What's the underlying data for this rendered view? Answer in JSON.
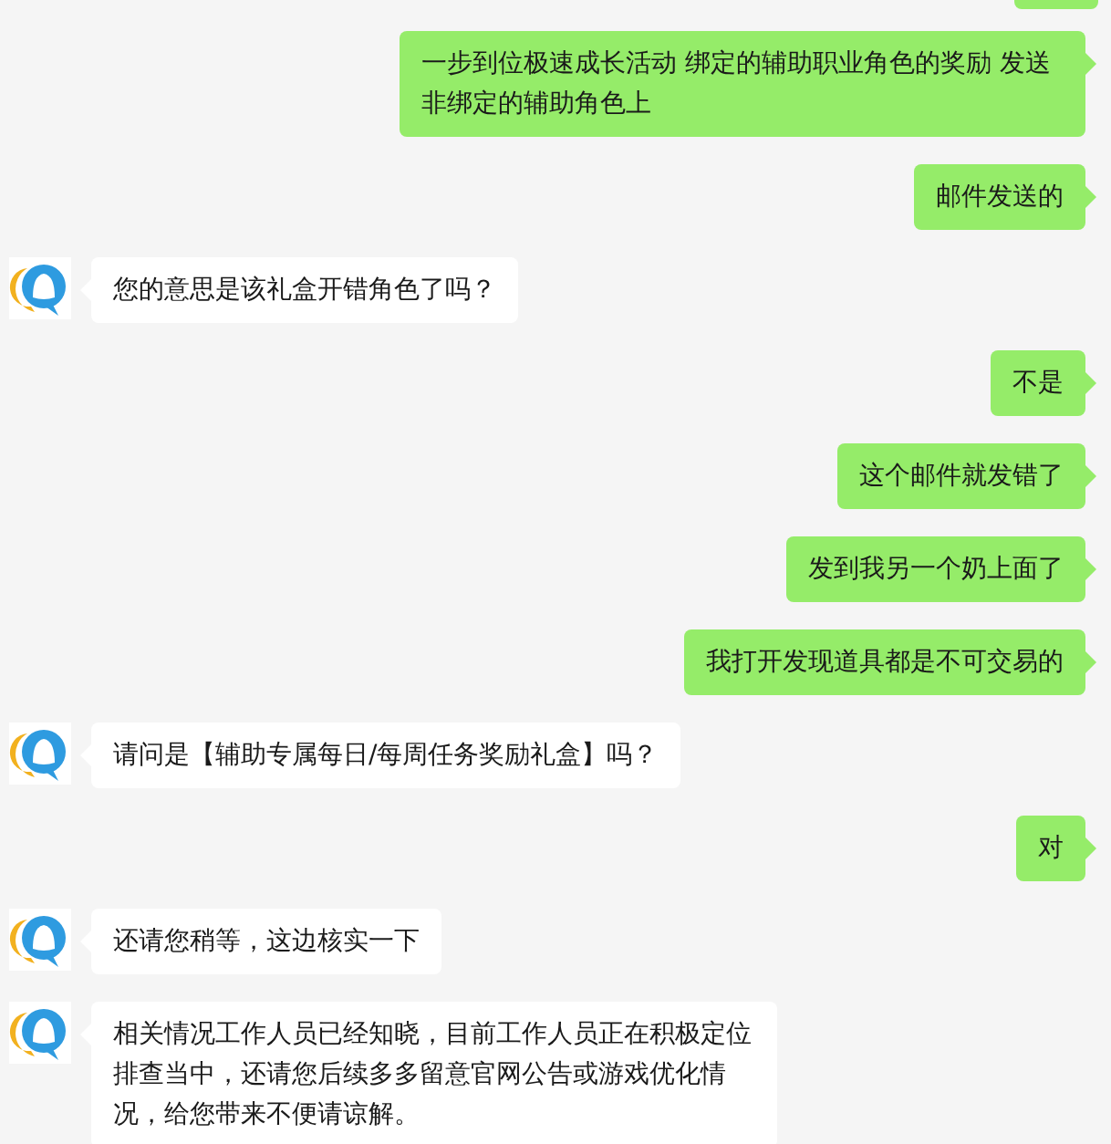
{
  "messages": [
    {
      "kind": "sent",
      "text": "一步到位极速成长活动 绑定的辅助职业角色的奖励 发送非绑定的辅助角色上"
    },
    {
      "kind": "sent",
      "text": "邮件发送的"
    },
    {
      "kind": "received",
      "text": "您的意思是该礼盒开错角色了吗？"
    },
    {
      "kind": "sent",
      "text": "不是"
    },
    {
      "kind": "sent",
      "text": "这个邮件就发错了"
    },
    {
      "kind": "sent",
      "text": "发到我另一个奶上面了"
    },
    {
      "kind": "sent",
      "text": "我打开发现道具都是不可交易的"
    },
    {
      "kind": "received",
      "text": "请问是【辅助专属每日/每周任务奖励礼盒】吗？"
    },
    {
      "kind": "sent",
      "text": "对"
    },
    {
      "kind": "received",
      "text": "还请您稍等，这边核实一下"
    },
    {
      "kind": "received",
      "text": "相关情况工作人员已经知晓，目前工作人员正在积极定位排查当中，还请您后续多多留意官网公告或游戏优化情况，给您带来不便请谅解。"
    }
  ]
}
